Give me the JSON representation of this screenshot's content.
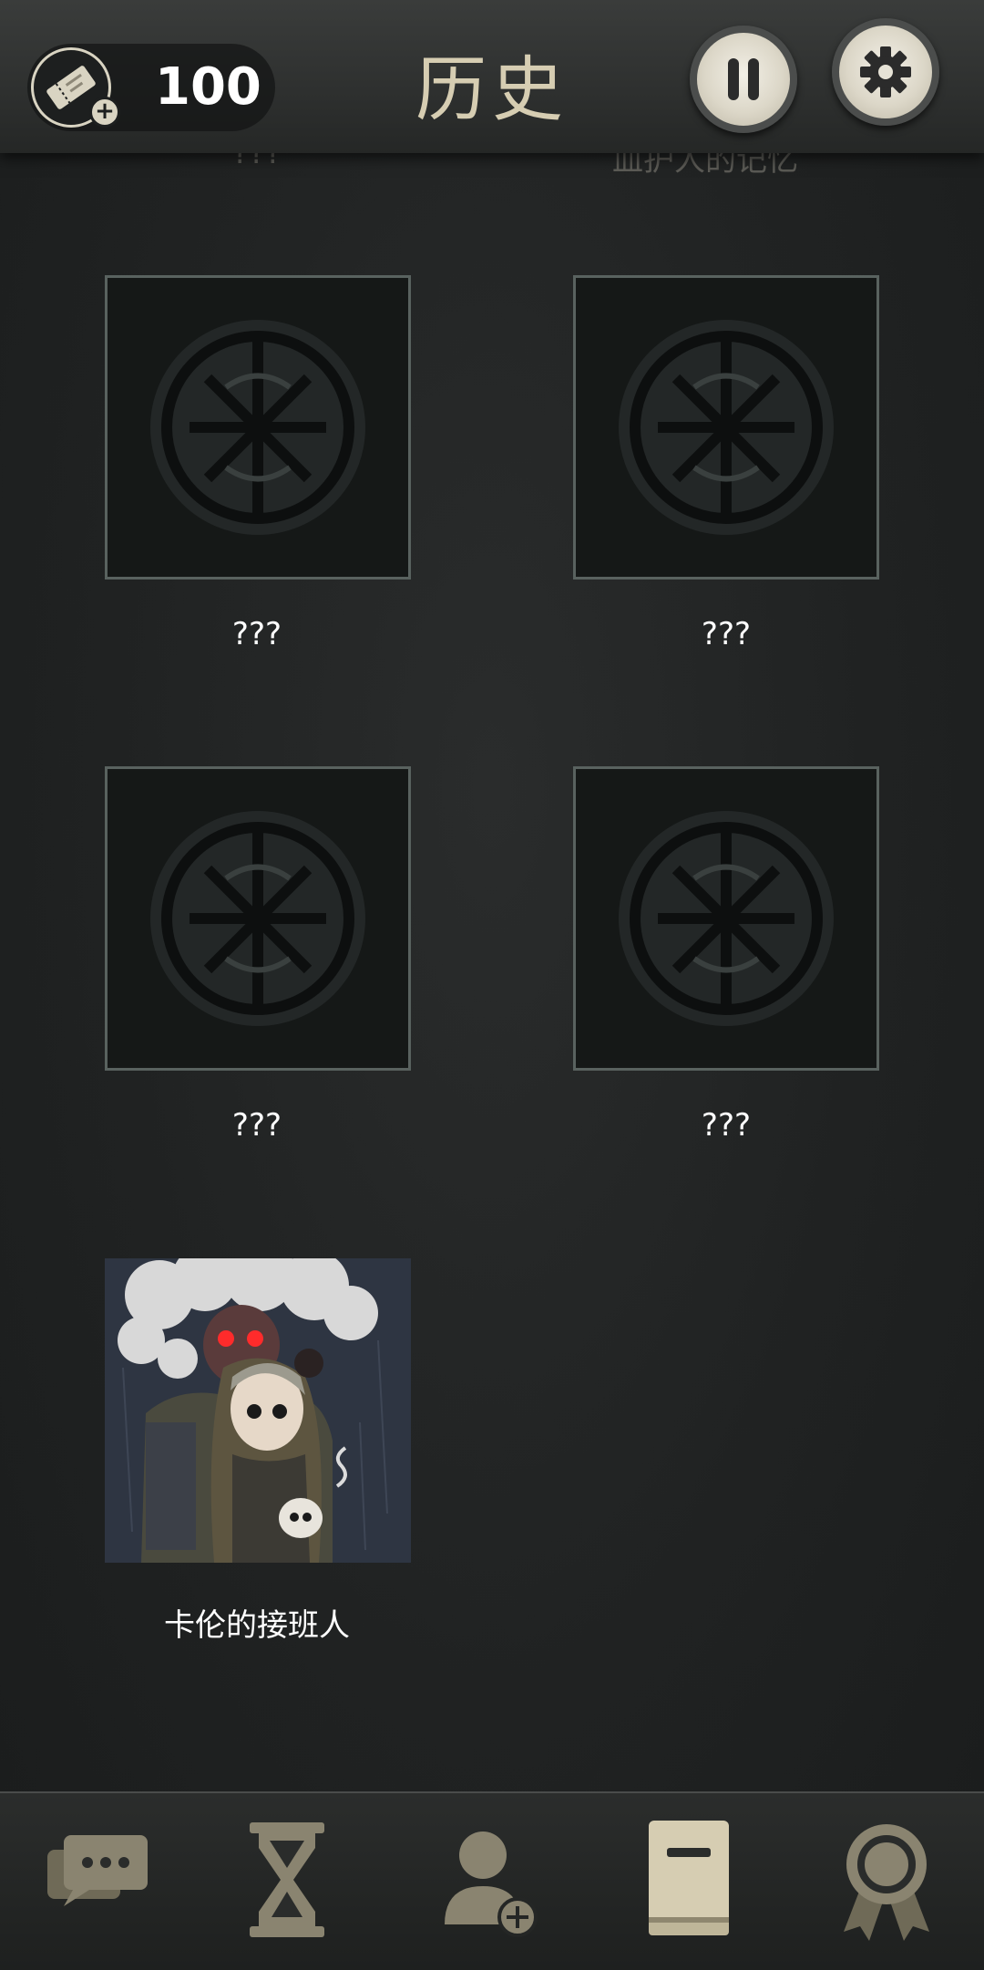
{
  "header": {
    "title": "历史",
    "currency_value": "100",
    "currency_icon": "ticket-icon",
    "pause_icon": "pause-icon",
    "settings_icon": "gear-icon",
    "peek_left": "???",
    "peek_right": "血护人的记忆"
  },
  "gallery": {
    "items": [
      {
        "label": "???",
        "state": "locked",
        "icon": "sigil-icon"
      },
      {
        "label": "???",
        "state": "locked",
        "icon": "sigil-icon"
      },
      {
        "label": "???",
        "state": "locked",
        "icon": "sigil-icon"
      },
      {
        "label": "???",
        "state": "locked",
        "icon": "sigil-icon"
      },
      {
        "label": "卡伦的接班人",
        "state": "unlocked",
        "icon": "story-illustration"
      }
    ]
  },
  "bottom_nav": {
    "items": [
      {
        "icon": "chat-icon",
        "active": false
      },
      {
        "icon": "hourglass-icon",
        "active": false
      },
      {
        "icon": "add-user-icon",
        "active": false
      },
      {
        "icon": "book-icon",
        "active": true
      },
      {
        "icon": "award-icon",
        "active": false
      }
    ]
  },
  "colors": {
    "accent": "#d6cdb2",
    "icon_muted": "#6f6a57",
    "background": "#222424"
  }
}
